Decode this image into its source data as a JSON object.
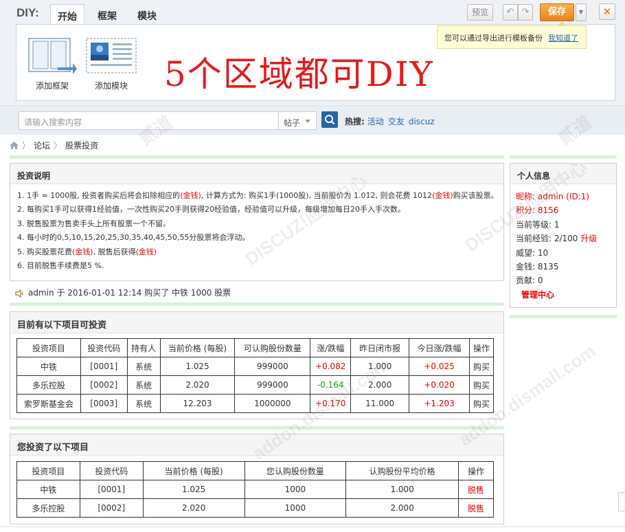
{
  "diy": {
    "label": "DIY:",
    "tabs": [
      "开始",
      "框架",
      "模块"
    ],
    "preview": "预览",
    "save": "保存",
    "close": "✕",
    "tip_text": "您可以通过导出进行模板备份",
    "tip_link": "我知道了",
    "items": [
      {
        "label": "添加框架",
        "icon": "frame-icon"
      },
      {
        "label": "添加模块",
        "icon": "module-icon"
      }
    ],
    "headline": "5个区域都可DIY"
  },
  "search": {
    "placeholder": "请输入搜索内容",
    "type": "帖子",
    "hot_label": "热搜:",
    "hot": [
      "活动",
      "交友",
      "discuz"
    ]
  },
  "breadcrumb": [
    "论坛",
    "股票投资"
  ],
  "rules": {
    "title": "投资说明",
    "lines": [
      {
        "pre": "1. 1手 = 1000股, 投资者购买后将会扣除相应的",
        "red1": "(金钱)",
        "mid": ", 计算方式为: 购买1手(1000股), 当前股价为 1.012, 则会花费 1012",
        "red2": "(金钱)",
        "post": "购买该股票。"
      },
      {
        "text": "2. 每购买1手可以获得1经验值，一次性购买20手则获得20经验值，经验值可以升级，每级增加每日20手入手次数。"
      },
      {
        "text": "3. 脱售股票为售卖手头上所有股票一个不留。"
      },
      {
        "text": "4. 每小时的0,5,10,15,20,25,30,35,40,45,50,55分股票将会浮动。"
      },
      {
        "pre": "5. 购买股票花费",
        "red1": "(金钱)",
        "mid": ", 脱售后获得",
        "red2": "(金钱)",
        "post": ""
      },
      {
        "text": "6. 目前脱售手续费是5 %."
      }
    ]
  },
  "notice": "admin 于 2016-01-01 12:14 购买了 中铁 1000 股票",
  "available": {
    "title": "目前有以下项目可投资",
    "headers": [
      "投资项目",
      "投资代码",
      "持有人",
      "当前价格 (每股)",
      "可认购股份数量",
      "涨/跌幅",
      "昨日闭市报",
      "今日涨/跌幅",
      "操作"
    ],
    "rows": [
      {
        "name": "中铁",
        "code": "[0001]",
        "holder": "系统",
        "price": "1.025",
        "qty": "999000",
        "change": "+0.082",
        "change_dir": "up",
        "close": "1.000",
        "today": "+0.025",
        "op": "购买"
      },
      {
        "name": "多乐控股",
        "code": "[0002]",
        "holder": "系统",
        "price": "2.020",
        "qty": "999000",
        "change": "-0.164",
        "change_dir": "down",
        "close": "2.000",
        "today": "+0.020",
        "op": "购买"
      },
      {
        "name": "索罗斯基金会",
        "code": "[0003]",
        "holder": "系统",
        "price": "12.203",
        "qty": "1000000",
        "change": "+0.170",
        "change_dir": "up",
        "close": "11.000",
        "today": "+1.203",
        "op": "购买"
      }
    ]
  },
  "mine": {
    "title": "您投资了以下项目",
    "headers": [
      "投资项目",
      "投资代码",
      "当前价格 (每股)",
      "您认购股份数量",
      "认购股份平均价格",
      "操作"
    ],
    "rows": [
      {
        "name": "中铁",
        "code": "[0001]",
        "price": "1.025",
        "qty": "1000",
        "avg": "1.000",
        "op": "脱售"
      },
      {
        "name": "多乐控股",
        "code": "[0002]",
        "price": "2.020",
        "qty": "1000",
        "avg": "2.000",
        "op": "脱售"
      }
    ]
  },
  "profile": {
    "title": "个人信息",
    "nickname": "昵称: admin (ID:1)",
    "points": "积分: 8156",
    "level": "当前等级: 1",
    "exp": "当前经验: 2/100",
    "upgrade": "升级",
    "prestige": "威望: 10",
    "money": "金钱: 8135",
    "contribution": "贡献: 0",
    "admin_center": "管理中心"
  },
  "watermarks": [
    "DISCUZ!应用中心",
    "addon.dismall.com",
    "贰道"
  ]
}
